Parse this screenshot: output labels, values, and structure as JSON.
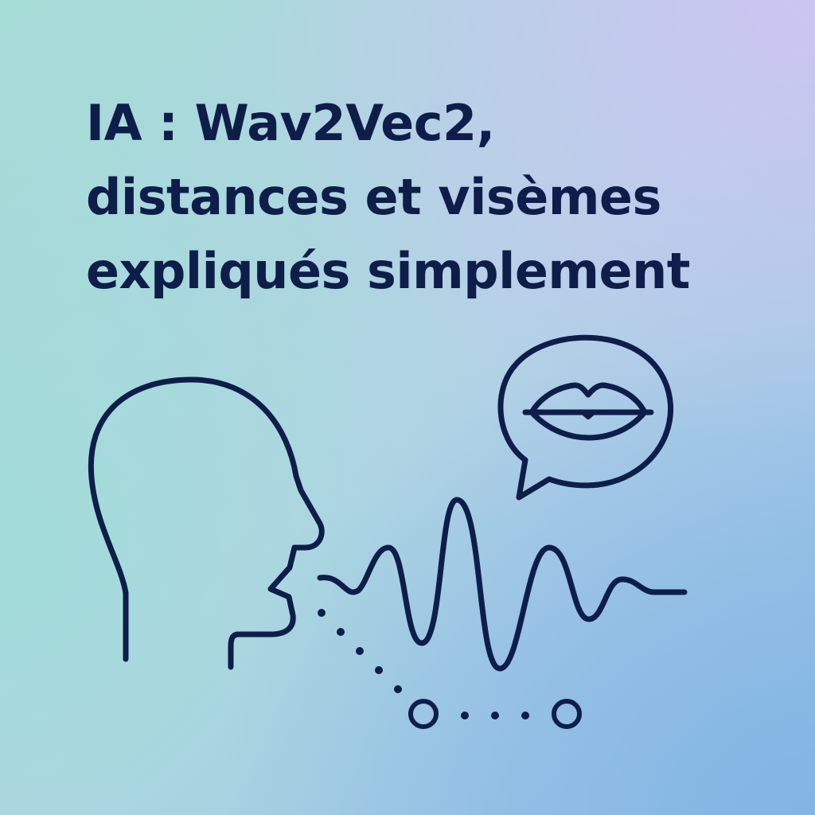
{
  "title": {
    "line1": "IA : Wav2Vec2,",
    "line2": "distances et visèmes",
    "line3": "expliqués simplement"
  },
  "colors": {
    "ink": "#0f1d4a",
    "background_top_left": "#a6dcd6",
    "background_top_right": "#cdc4f3",
    "background_bottom_right": "#80b4e4"
  },
  "icons": {
    "head": "speaking-head-icon",
    "bubble": "speech-bubble-icon",
    "lips": "lips-icon",
    "wave": "sound-wave-icon",
    "dots": "dotted-path-icon"
  }
}
